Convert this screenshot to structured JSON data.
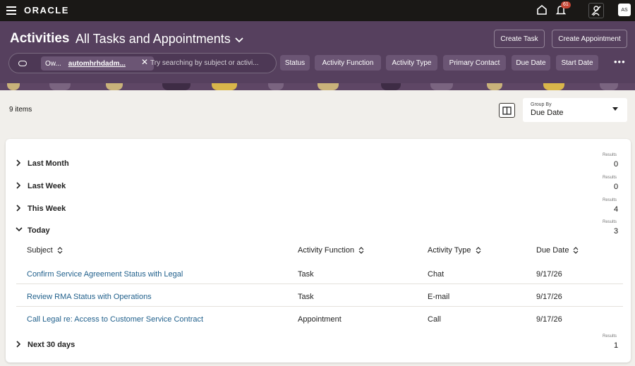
{
  "app": {
    "brand": "ORACLE"
  },
  "topbar": {
    "icons": [
      "menu-icon",
      "home-icon",
      "bell-icon",
      "people-icon"
    ],
    "notification_count": "61",
    "user_initials": "AS"
  },
  "header": {
    "title": "Activities",
    "view": "All Tasks and Appointments",
    "create_task": "Create Task",
    "create_appointment": "Create Appointment"
  },
  "search": {
    "owner_label": "Ow...",
    "owner_value": "automhrhdadm...",
    "placeholder": "Try searching by subject or activi..."
  },
  "filters": [
    "Status",
    "Activity Function",
    "Activity Type",
    "Primary Contact",
    "Due Date",
    "Start Date"
  ],
  "toolbar": {
    "items_count": "9 items",
    "groupby_label": "Group By",
    "groupby_value": "Due Date"
  },
  "groups": [
    {
      "name": "Last Month",
      "results_label": "Results",
      "count": "0",
      "expanded": false
    },
    {
      "name": "Last Week",
      "results_label": "Results",
      "count": "0",
      "expanded": false
    },
    {
      "name": "This Week",
      "results_label": "Results",
      "count": "4",
      "expanded": false
    },
    {
      "name": "Today",
      "results_label": "Results",
      "count": "3",
      "expanded": true
    },
    {
      "name": "Next 30 days",
      "results_label": "Results",
      "count": "1",
      "expanded": false
    }
  ],
  "table": {
    "columns": [
      "Subject",
      "Activity Function",
      "Activity Type",
      "Due Date"
    ],
    "rows": [
      {
        "subject": "Confirm Service Agreement Status with Legal",
        "function": "Task",
        "type": "Chat",
        "due": "9/17/26"
      },
      {
        "subject": "Review RMA Status with Operations",
        "function": "Task",
        "type": "E-mail",
        "due": "9/17/26"
      },
      {
        "subject": "Call Legal re: Access to Customer Service Contract",
        "function": "Appointment",
        "type": "Call",
        "due": "9/17/26"
      }
    ]
  },
  "colors": {
    "header_bg": "#56405e",
    "topbar_bg": "#1a1816",
    "link": "#1f5f8b",
    "badge": "#c74634"
  }
}
